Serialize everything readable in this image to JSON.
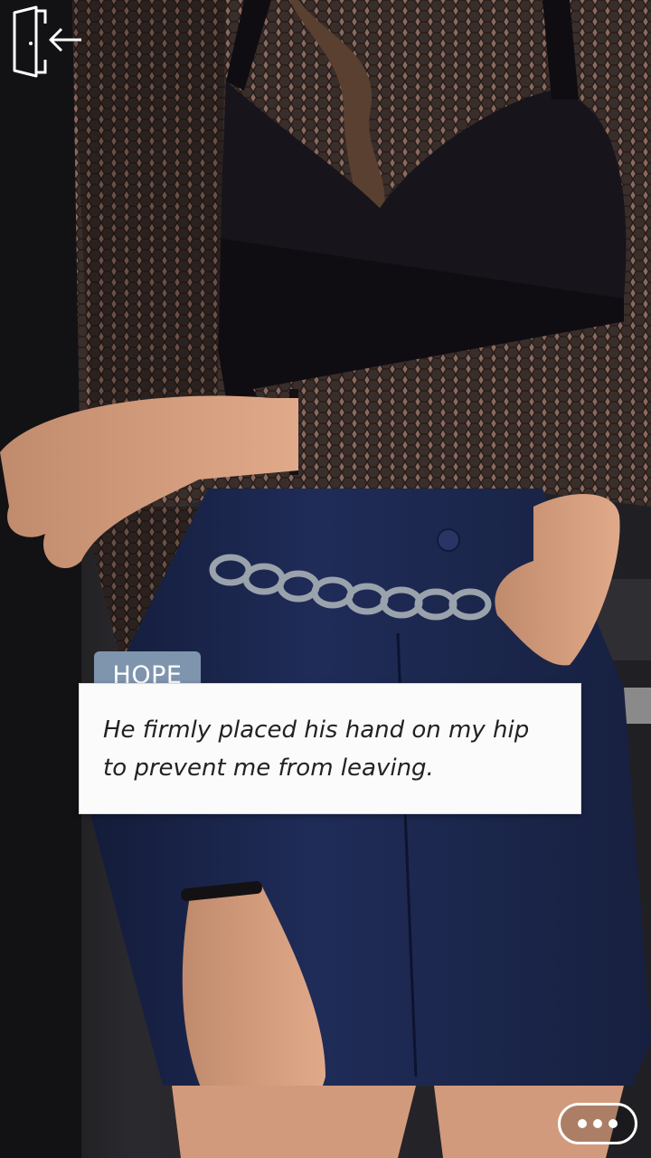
{
  "scene": {
    "description_icon": "story-scene-illustration"
  },
  "controls": {
    "exit_icon": "exit-door-icon",
    "more_icon": "ellipsis-icon"
  },
  "dialogue": {
    "speaker": "HOPE",
    "text": "He firmly placed his hand on my hip to prevent me from leaving."
  },
  "colors": {
    "speaker_tag_bg": "#7f95ae",
    "dialogue_bg": "#fbfbfb",
    "dialogue_text": "#222222"
  }
}
